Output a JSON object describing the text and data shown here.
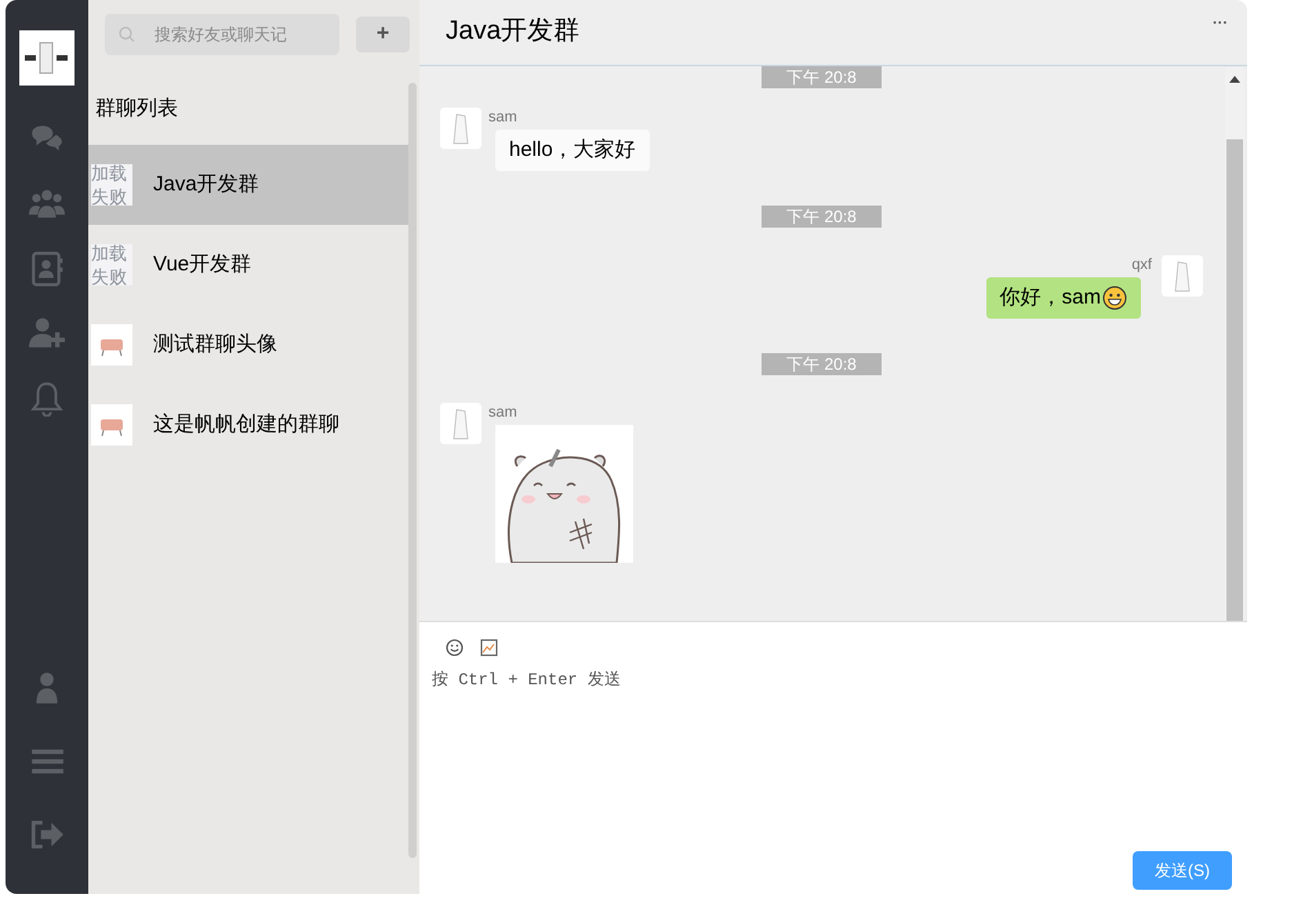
{
  "nav": {
    "top": [
      {
        "kind": "chat"
      },
      {
        "kind": "group"
      },
      {
        "kind": "contacts"
      },
      {
        "kind": "add-user"
      },
      {
        "kind": "bell"
      }
    ],
    "bottom": [
      {
        "kind": "user"
      },
      {
        "kind": "menu"
      },
      {
        "kind": "logout"
      }
    ]
  },
  "search": {
    "placeholder": "搜索好友或聊天记"
  },
  "add_button": "+",
  "list": {
    "title": "群聊列表",
    "items": [
      {
        "name": "Java开发群",
        "avatar": {
          "kind": "failed",
          "text": "加载失败"
        },
        "selected": true
      },
      {
        "name": "Vue开发群",
        "avatar": {
          "kind": "failed",
          "text": "加载失败"
        },
        "selected": false
      },
      {
        "name": "测试群聊头像",
        "avatar": {
          "kind": "image"
        },
        "selected": false
      },
      {
        "name": "这是帆帆创建的群聊",
        "avatar": {
          "kind": "image"
        },
        "selected": false
      }
    ]
  },
  "chat": {
    "title": "Java开发群",
    "menu": "···",
    "messages": [
      {
        "kind": "time",
        "text": "下午 20:8"
      },
      {
        "kind": "text",
        "sender": "sam",
        "mine": false,
        "text": "hello，大家好",
        "emoji": false
      },
      {
        "kind": "time",
        "text": "下午 20:8"
      },
      {
        "kind": "text",
        "sender": "qxf",
        "mine": true,
        "text": "你好，sam",
        "emoji": true
      },
      {
        "kind": "time",
        "text": "下午 20:8"
      },
      {
        "kind": "image",
        "sender": "sam",
        "mine": false
      }
    ]
  },
  "composer": {
    "placeholder": "按 Ctrl + Enter 发送",
    "send": "发送(S)"
  }
}
